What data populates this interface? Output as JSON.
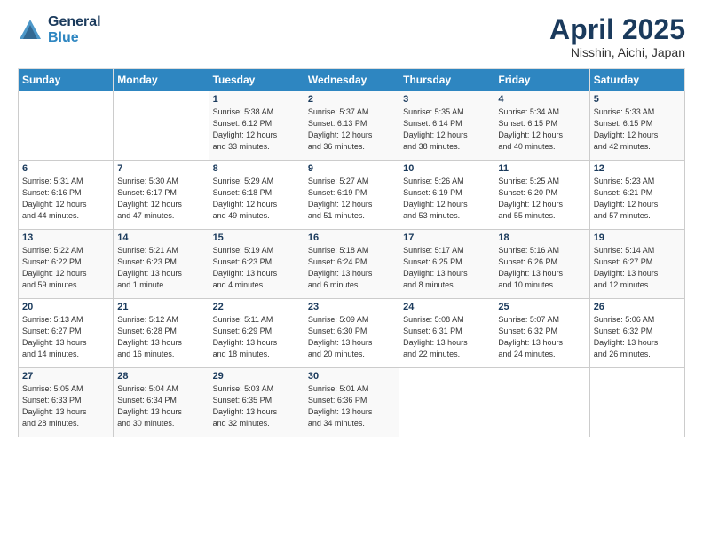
{
  "logo": {
    "line1": "General",
    "line2": "Blue"
  },
  "header": {
    "month": "April 2025",
    "location": "Nisshin, Aichi, Japan"
  },
  "days_of_week": [
    "Sunday",
    "Monday",
    "Tuesday",
    "Wednesday",
    "Thursday",
    "Friday",
    "Saturday"
  ],
  "weeks": [
    [
      {
        "day": "",
        "info": ""
      },
      {
        "day": "",
        "info": ""
      },
      {
        "day": "1",
        "info": "Sunrise: 5:38 AM\nSunset: 6:12 PM\nDaylight: 12 hours\nand 33 minutes."
      },
      {
        "day": "2",
        "info": "Sunrise: 5:37 AM\nSunset: 6:13 PM\nDaylight: 12 hours\nand 36 minutes."
      },
      {
        "day": "3",
        "info": "Sunrise: 5:35 AM\nSunset: 6:14 PM\nDaylight: 12 hours\nand 38 minutes."
      },
      {
        "day": "4",
        "info": "Sunrise: 5:34 AM\nSunset: 6:15 PM\nDaylight: 12 hours\nand 40 minutes."
      },
      {
        "day": "5",
        "info": "Sunrise: 5:33 AM\nSunset: 6:15 PM\nDaylight: 12 hours\nand 42 minutes."
      }
    ],
    [
      {
        "day": "6",
        "info": "Sunrise: 5:31 AM\nSunset: 6:16 PM\nDaylight: 12 hours\nand 44 minutes."
      },
      {
        "day": "7",
        "info": "Sunrise: 5:30 AM\nSunset: 6:17 PM\nDaylight: 12 hours\nand 47 minutes."
      },
      {
        "day": "8",
        "info": "Sunrise: 5:29 AM\nSunset: 6:18 PM\nDaylight: 12 hours\nand 49 minutes."
      },
      {
        "day": "9",
        "info": "Sunrise: 5:27 AM\nSunset: 6:19 PM\nDaylight: 12 hours\nand 51 minutes."
      },
      {
        "day": "10",
        "info": "Sunrise: 5:26 AM\nSunset: 6:19 PM\nDaylight: 12 hours\nand 53 minutes."
      },
      {
        "day": "11",
        "info": "Sunrise: 5:25 AM\nSunset: 6:20 PM\nDaylight: 12 hours\nand 55 minutes."
      },
      {
        "day": "12",
        "info": "Sunrise: 5:23 AM\nSunset: 6:21 PM\nDaylight: 12 hours\nand 57 minutes."
      }
    ],
    [
      {
        "day": "13",
        "info": "Sunrise: 5:22 AM\nSunset: 6:22 PM\nDaylight: 12 hours\nand 59 minutes."
      },
      {
        "day": "14",
        "info": "Sunrise: 5:21 AM\nSunset: 6:23 PM\nDaylight: 13 hours\nand 1 minute."
      },
      {
        "day": "15",
        "info": "Sunrise: 5:19 AM\nSunset: 6:23 PM\nDaylight: 13 hours\nand 4 minutes."
      },
      {
        "day": "16",
        "info": "Sunrise: 5:18 AM\nSunset: 6:24 PM\nDaylight: 13 hours\nand 6 minutes."
      },
      {
        "day": "17",
        "info": "Sunrise: 5:17 AM\nSunset: 6:25 PM\nDaylight: 13 hours\nand 8 minutes."
      },
      {
        "day": "18",
        "info": "Sunrise: 5:16 AM\nSunset: 6:26 PM\nDaylight: 13 hours\nand 10 minutes."
      },
      {
        "day": "19",
        "info": "Sunrise: 5:14 AM\nSunset: 6:27 PM\nDaylight: 13 hours\nand 12 minutes."
      }
    ],
    [
      {
        "day": "20",
        "info": "Sunrise: 5:13 AM\nSunset: 6:27 PM\nDaylight: 13 hours\nand 14 minutes."
      },
      {
        "day": "21",
        "info": "Sunrise: 5:12 AM\nSunset: 6:28 PM\nDaylight: 13 hours\nand 16 minutes."
      },
      {
        "day": "22",
        "info": "Sunrise: 5:11 AM\nSunset: 6:29 PM\nDaylight: 13 hours\nand 18 minutes."
      },
      {
        "day": "23",
        "info": "Sunrise: 5:09 AM\nSunset: 6:30 PM\nDaylight: 13 hours\nand 20 minutes."
      },
      {
        "day": "24",
        "info": "Sunrise: 5:08 AM\nSunset: 6:31 PM\nDaylight: 13 hours\nand 22 minutes."
      },
      {
        "day": "25",
        "info": "Sunrise: 5:07 AM\nSunset: 6:32 PM\nDaylight: 13 hours\nand 24 minutes."
      },
      {
        "day": "26",
        "info": "Sunrise: 5:06 AM\nSunset: 6:32 PM\nDaylight: 13 hours\nand 26 minutes."
      }
    ],
    [
      {
        "day": "27",
        "info": "Sunrise: 5:05 AM\nSunset: 6:33 PM\nDaylight: 13 hours\nand 28 minutes."
      },
      {
        "day": "28",
        "info": "Sunrise: 5:04 AM\nSunset: 6:34 PM\nDaylight: 13 hours\nand 30 minutes."
      },
      {
        "day": "29",
        "info": "Sunrise: 5:03 AM\nSunset: 6:35 PM\nDaylight: 13 hours\nand 32 minutes."
      },
      {
        "day": "30",
        "info": "Sunrise: 5:01 AM\nSunset: 6:36 PM\nDaylight: 13 hours\nand 34 minutes."
      },
      {
        "day": "",
        "info": ""
      },
      {
        "day": "",
        "info": ""
      },
      {
        "day": "",
        "info": ""
      }
    ]
  ]
}
